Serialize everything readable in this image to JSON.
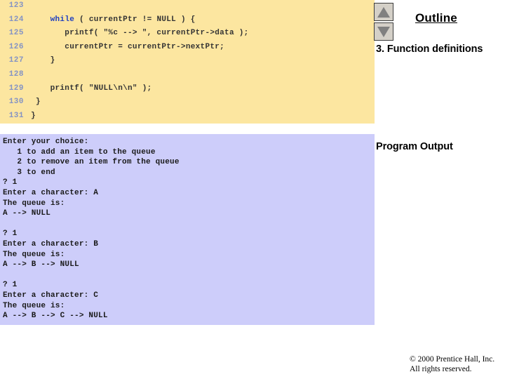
{
  "code_panel": {
    "lines": [
      {
        "number": "123",
        "indent": 0,
        "segments": []
      },
      {
        "number": "124",
        "indent": 0,
        "segments": [
          {
            "text": "    ",
            "kind": "plain"
          },
          {
            "text": "while",
            "kind": "keyword"
          },
          {
            "text": " ( currentPtr != NULL ) {",
            "kind": "plain"
          }
        ]
      },
      {
        "number": "125",
        "indent": 0,
        "segments": [
          {
            "text": "       printf( \"%c --> \", currentPtr->data );",
            "kind": "plain"
          }
        ]
      },
      {
        "number": "126",
        "indent": 0,
        "segments": [
          {
            "text": "       currentPtr = currentPtr->nextPtr;",
            "kind": "plain"
          }
        ]
      },
      {
        "number": "127",
        "indent": 0,
        "segments": [
          {
            "text": "    }",
            "kind": "plain"
          }
        ]
      },
      {
        "number": "128",
        "indent": 0,
        "segments": []
      },
      {
        "number": "129",
        "indent": 0,
        "segments": [
          {
            "text": "    printf( \"NULL\\n\\n\" );",
            "kind": "plain"
          }
        ]
      },
      {
        "number": "130",
        "indent": 0,
        "segments": [
          {
            "text": " }",
            "kind": "plain"
          }
        ]
      },
      {
        "number": "131",
        "indent": 0,
        "segments": [
          {
            "text": "}",
            "kind": "plain"
          }
        ]
      }
    ]
  },
  "output_panel": {
    "lines": [
      "Enter your choice:",
      "   1 to add an item to the queue",
      "   2 to remove an item from the queue",
      "   3 to end",
      "? 1",
      "Enter a character: A",
      "The queue is:",
      "A --> NULL",
      "",
      "? 1",
      "Enter a character: B",
      "The queue is:",
      "A --> B --> NULL",
      "",
      "? 1",
      "Enter a character: C",
      "The queue is:",
      "A --> B --> C --> NULL"
    ]
  },
  "right_rail": {
    "outline_title": "Outline",
    "outline_entry": "3. Function definitions",
    "program_output_label": "Program Output",
    "nav_up_icon": "triangle-up-icon",
    "nav_down_icon": "triangle-down-icon"
  },
  "footer": {
    "line1": "© 2000 Prentice Hall, Inc.",
    "line2": "All rights reserved."
  },
  "colors": {
    "code_background": "#fce6a0",
    "output_background": "#cdcdfa",
    "line_number": "#8493c4",
    "keyword": "#1f3fc0",
    "code_text": "#333333"
  }
}
